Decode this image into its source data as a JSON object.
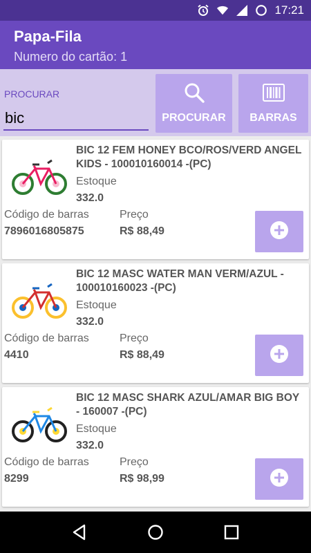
{
  "status_bar": {
    "time": "17:21",
    "icons": [
      "alarm-icon",
      "wifi-icon",
      "signal-icon",
      "battery-icon"
    ]
  },
  "app_bar": {
    "title": "Papa-Fila",
    "subtitle": "Numero do cartão: 1"
  },
  "search": {
    "label": "PROCURAR",
    "value": "bic",
    "search_button": {
      "label": "PROCURAR",
      "icon": "search-icon"
    },
    "barcode_button": {
      "label": "BARRAS",
      "icon": "barcode-icon"
    }
  },
  "products": [
    {
      "name": "BIC 12 FEM HONEY BCO/ROS/VERD ANGEL KIDS - 100010160014 -(PC)",
      "stock_label": "Estoque",
      "stock": "332.0",
      "barcode_label": "Código de barras",
      "barcode": "7896016805875",
      "price_label": "Preço",
      "price": "R$ 88,49",
      "colors": {
        "frame": "#e8f5e9",
        "accent": "#e91e63",
        "wheel": "#2e7d32"
      }
    },
    {
      "name": "BIC 12 MASC WATER MAN VERM/AZUL - 100010160023 -(PC)",
      "stock_label": "Estoque",
      "stock": "332.0",
      "barcode_label": "Código de barras",
      "barcode": "4410",
      "price_label": "Preço",
      "price": "R$ 88,49",
      "colors": {
        "frame": "#d32f2f",
        "accent": "#1565c0",
        "wheel": "#fbc02d"
      }
    },
    {
      "name": "BIC 12 MASC SHARK AZUL/AMAR BIG BOY - 160007 -(PC)",
      "stock_label": "Estoque",
      "stock": "332.0",
      "barcode_label": "Código de barras",
      "barcode": "8299",
      "price_label": "Preço",
      "price": "R$ 98,99",
      "colors": {
        "frame": "#1e88e5",
        "accent": "#fdd835",
        "wheel": "#212121"
      }
    }
  ],
  "theme": {
    "primary": "#6a49bf",
    "primary_dark": "#4b3292",
    "accent_light": "#b9a5ec",
    "search_bg": "#d4c9ec"
  },
  "nav_bar": {
    "buttons": [
      "back-icon",
      "home-icon",
      "recents-icon"
    ]
  }
}
